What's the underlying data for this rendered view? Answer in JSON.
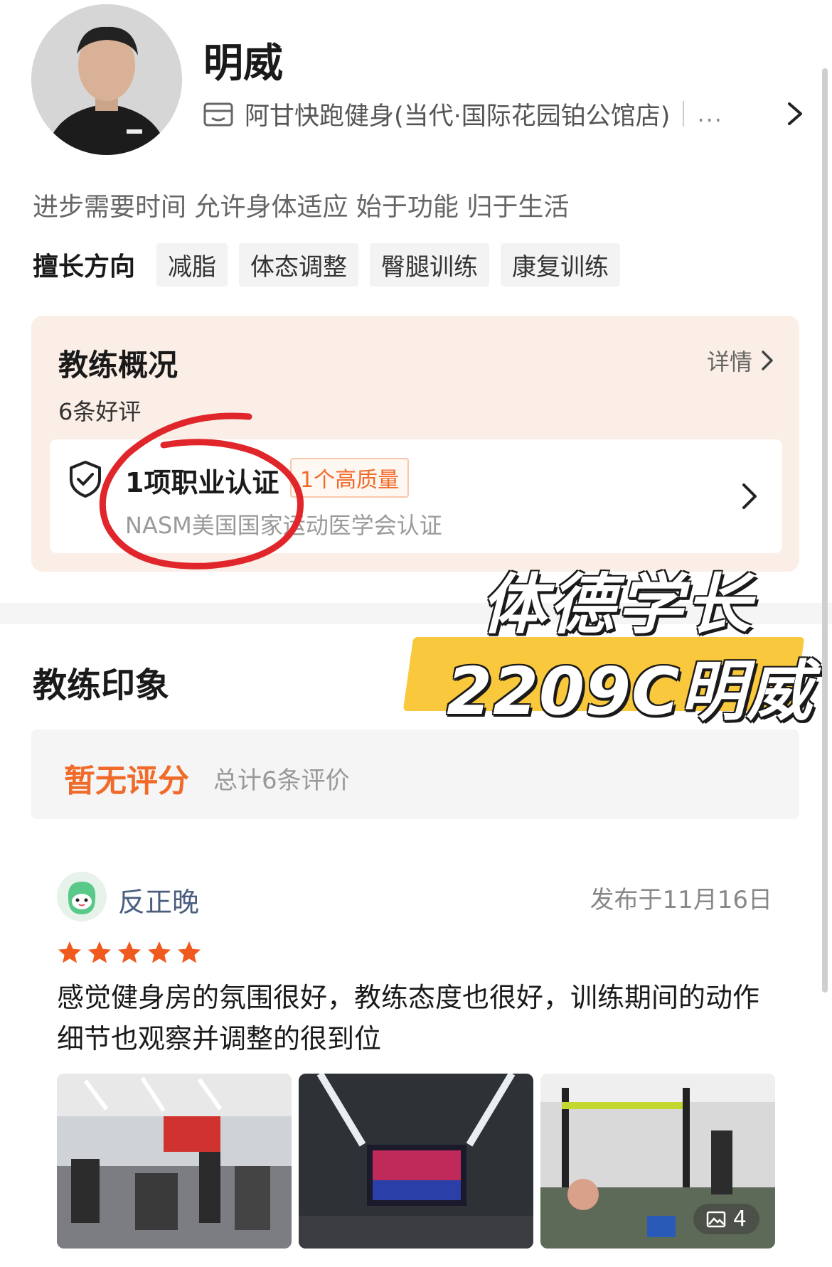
{
  "profile": {
    "name": "明威",
    "store": "阿甘快跑健身(当代·国际花园铂公馆店)",
    "store_more": "...",
    "motto": "进步需要时间 允许身体适应 始于功能 归于生活"
  },
  "skills": {
    "label": "擅长方向",
    "tags": [
      "减脂",
      "体态调整",
      "臀腿训练",
      "康复训练"
    ]
  },
  "overview": {
    "title": "教练概况",
    "detail": "详情",
    "reviews": "6条好评",
    "cert_title": "1项职业认证",
    "cert_badge": "1个高质量",
    "cert_desc": "NASM美国国家运动医学会认证"
  },
  "watermark": {
    "line1": "体德学长",
    "line2": "2209C明威"
  },
  "impression": {
    "title": "教练印象",
    "rating": "暂无评分",
    "total": "总计6条评价"
  },
  "review": {
    "user": "反正晚",
    "date": "发布于11月16日",
    "stars": 5,
    "text": "感觉健身房的氛围很好，教练态度也很好，训练期间的动作细节也观察并调整的很到位",
    "photo_count": "4"
  },
  "colors": {
    "accent": "#f06a2a",
    "card_bg": "#faeee6",
    "star": "#f05a1e",
    "annotation": "#e0262a",
    "watermark_band": "#f9c83c"
  }
}
